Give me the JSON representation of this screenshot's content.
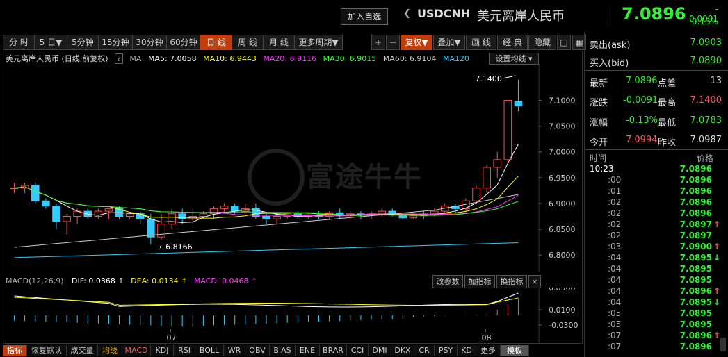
{
  "header": {
    "add_watch": "加入自选",
    "nav_prev": "❮",
    "nav_next": "❯",
    "symbol": "USDCNH",
    "name": "美元离岸人民币",
    "price": "7.0896",
    "change": "- 0.0091",
    "change_pct": "- 0.13%"
  },
  "toolbar": {
    "items": [
      "分 时",
      "5 日▼",
      "5分钟",
      "15分钟",
      "30分钟",
      "60分钟",
      "日 线",
      "周 线",
      "月 线",
      "更多周期▼"
    ],
    "active_index": 6,
    "right_items": [
      "+",
      "−",
      "复权▼",
      "叠加▼",
      "画 线",
      "经 典",
      "隐藏"
    ],
    "icons": [
      "square-icon",
      "grid-icon"
    ]
  },
  "legend": {
    "title": "美元离岸人民币 (日线,前复权)",
    "help": "?",
    "ma_label": "MA",
    "ma5": "MA5: 7.0058",
    "ma10": "MA10: 6.9443",
    "ma20": "MA20: 6.9116",
    "ma30": "MA30: 6.9015",
    "ma60": "MA60: 6.9104",
    "ma120": "MA120",
    "settings": "设置均线 ▾"
  },
  "colors": {
    "ma5": "#ffffff",
    "ma10": "#ffff00",
    "ma20": "#ff33ff",
    "ma30": "#33ff33",
    "ma60": "#cccccc",
    "ma120": "#33ccff",
    "up": "#ff4d4d",
    "down": "#33ccff",
    "active": "#c23d0c"
  },
  "chart_data": {
    "type": "candlestick",
    "y_ticks": [
      "7.1000",
      "7.0500",
      "7.0000",
      "6.9500",
      "6.9000",
      "6.8500",
      "6.8000"
    ],
    "ylim": [
      6.78,
      7.16
    ],
    "x_labels": [
      "07",
      "08"
    ],
    "annotations": {
      "high": "7.1400",
      "low": "6.8166"
    },
    "candles": [
      [
        6.93,
        6.94,
        6.92,
        6.93
      ],
      [
        6.93,
        6.94,
        6.92,
        6.935
      ],
      [
        6.935,
        6.94,
        6.9,
        6.905
      ],
      [
        6.905,
        6.91,
        6.89,
        6.895
      ],
      [
        6.895,
        6.9,
        6.85,
        6.865
      ],
      [
        6.865,
        6.88,
        6.84,
        6.875
      ],
      [
        6.875,
        6.89,
        6.86,
        6.885
      ],
      [
        6.885,
        6.89,
        6.87,
        6.875
      ],
      [
        6.875,
        6.89,
        6.87,
        6.885
      ],
      [
        6.885,
        6.89,
        6.87,
        6.89
      ],
      [
        6.89,
        6.895,
        6.87,
        6.875
      ],
      [
        6.875,
        6.88,
        6.87,
        6.88
      ],
      [
        6.88,
        6.885,
        6.86,
        6.87
      ],
      [
        6.87,
        6.88,
        6.82,
        6.835
      ],
      [
        6.835,
        6.88,
        6.83,
        6.86
      ],
      [
        6.86,
        6.89,
        6.85,
        6.88
      ],
      [
        6.88,
        6.89,
        6.86,
        6.87
      ],
      [
        6.87,
        6.89,
        6.86,
        6.875
      ],
      [
        6.875,
        6.885,
        6.87,
        6.88
      ],
      [
        6.88,
        6.895,
        6.87,
        6.89
      ],
      [
        6.89,
        6.9,
        6.88,
        6.895
      ],
      [
        6.895,
        6.9,
        6.88,
        6.885
      ],
      [
        6.885,
        6.9,
        6.88,
        6.89
      ],
      [
        6.89,
        6.9,
        6.87,
        6.875
      ],
      [
        6.875,
        6.88,
        6.86,
        6.87
      ],
      [
        6.87,
        6.88,
        6.86,
        6.875
      ],
      [
        6.875,
        6.88,
        6.87,
        6.88
      ],
      [
        6.88,
        6.885,
        6.87,
        6.875
      ],
      [
        6.875,
        6.88,
        6.87,
        6.878
      ],
      [
        6.878,
        6.885,
        6.87,
        6.875
      ],
      [
        6.875,
        6.885,
        6.87,
        6.882
      ],
      [
        6.882,
        6.89,
        6.87,
        6.876
      ],
      [
        6.876,
        6.885,
        6.87,
        6.88
      ],
      [
        6.88,
        6.885,
        6.87,
        6.878
      ],
      [
        6.878,
        6.885,
        6.87,
        6.88
      ],
      [
        6.88,
        6.89,
        6.875,
        6.885
      ],
      [
        6.885,
        6.89,
        6.875,
        6.878
      ],
      [
        6.878,
        6.88,
        6.87,
        6.872
      ],
      [
        6.872,
        6.88,
        6.87,
        6.876
      ],
      [
        6.876,
        6.885,
        6.87,
        6.88
      ],
      [
        6.88,
        6.89,
        6.875,
        6.885
      ],
      [
        6.885,
        6.9,
        6.88,
        6.895
      ],
      [
        6.895,
        6.9,
        6.88,
        6.89
      ],
      [
        6.89,
        6.91,
        6.885,
        6.905
      ],
      [
        6.905,
        6.935,
        6.9,
        6.93
      ],
      [
        6.93,
        6.975,
        6.92,
        6.97
      ],
      [
        6.97,
        7.0,
        6.95,
        6.985
      ],
      [
        6.985,
        7.1,
        6.98,
        7.1
      ],
      [
        7.0987,
        7.14,
        7.0783,
        7.0896
      ]
    ]
  },
  "macd": {
    "label": "MACD(12,26,9)",
    "dif": "DIF: 0.0368",
    "dea": "DEA: 0.0134",
    "macd": "MACD: 0.0468",
    "buttons": [
      "改参数",
      "加指标",
      "换指标",
      "×"
    ],
    "y_ticks": [
      "0.0500",
      "0.0100",
      "-0.0300"
    ]
  },
  "watermark": "富途牛牛",
  "bottom_tabs": [
    "指标",
    "恢复默认",
    "成交量",
    "均线",
    "MACD",
    "KDJ",
    "RSI",
    "BOLL",
    "WR",
    "OBV",
    "BIAS",
    "ENE",
    "BRAR",
    "CCI",
    "DMI",
    "DKX",
    "CR",
    "PSY",
    "KD",
    "更多",
    "模板"
  ],
  "quote": {
    "ask_label": "卖出(ask)",
    "ask": "7.0903",
    "bid_label": "买入(bid)",
    "bid": "7.0890",
    "latest_label": "最新",
    "latest": "7.0896",
    "spread_label": "点差",
    "spread": "13",
    "chg_label": "涨跌",
    "chg": "-0.0091",
    "high_label": "最高",
    "high": "7.1400",
    "pct_label": "涨幅",
    "pct": "-0.13%",
    "low_label": "最低",
    "low": "7.0783",
    "open_label": "今开",
    "open": "7.0994",
    "prev_label": "昨收",
    "prev": "7.0987"
  },
  "ticks": {
    "time_header": "时间",
    "price_header": "价格",
    "rows": [
      {
        "time": "10:23",
        "price": "7.0896",
        "dir": ""
      },
      {
        "time": ":00",
        "price": "7.0896",
        "dir": ""
      },
      {
        "time": ":01",
        "price": "7.0896",
        "dir": ""
      },
      {
        "time": ":02",
        "price": "7.0896",
        "dir": ""
      },
      {
        "time": ":02",
        "price": "7.0896",
        "dir": ""
      },
      {
        "time": ":02",
        "price": "7.0897",
        "dir": "up"
      },
      {
        "time": ":02",
        "price": "7.0897",
        "dir": ""
      },
      {
        "time": ":03",
        "price": "7.0900",
        "dir": "up"
      },
      {
        "time": ":04",
        "price": "7.0895",
        "dir": "down"
      },
      {
        "time": ":04",
        "price": "7.0895",
        "dir": ""
      },
      {
        "time": ":04",
        "price": "7.0895",
        "dir": ""
      },
      {
        "time": ":04",
        "price": "7.0896",
        "dir": "up"
      },
      {
        "time": ":04",
        "price": "7.0895",
        "dir": "down"
      },
      {
        "time": ":05",
        "price": "7.0895",
        "dir": ""
      },
      {
        "time": ":05",
        "price": "7.0895",
        "dir": ""
      },
      {
        "time": ":07",
        "price": "7.0896",
        "dir": "up"
      },
      {
        "time": ":07",
        "price": "7.0896",
        "dir": ""
      }
    ]
  }
}
